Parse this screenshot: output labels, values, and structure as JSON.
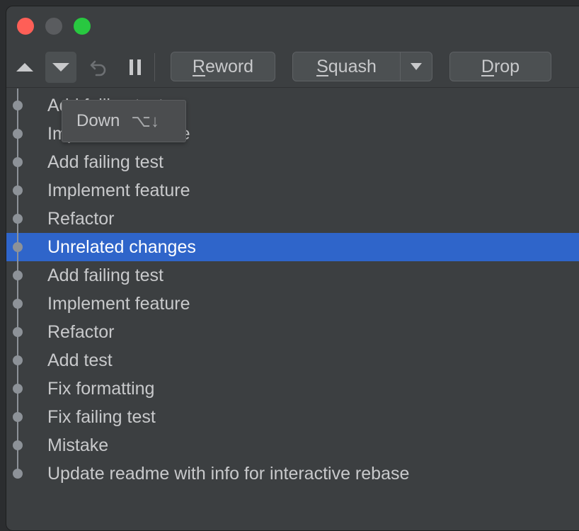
{
  "window": {
    "title": ""
  },
  "toolbar": {
    "move_up_icon": "triangle-up-icon",
    "move_down_icon": "triangle-down-icon",
    "undo_icon": "undo-icon",
    "pause_icon": "pause-icon",
    "reword": {
      "pre": "",
      "mnemonic": "R",
      "post": "eword"
    },
    "squash": {
      "pre": "",
      "mnemonic": "S",
      "post": "quash"
    },
    "drop": {
      "pre": "",
      "mnemonic": "D",
      "post": "rop"
    }
  },
  "tooltip": {
    "label": "Down",
    "shortcut": "⌥↓"
  },
  "commits": [
    {
      "message": "Add failing test",
      "selected": false
    },
    {
      "message": "Implement feature",
      "selected": false
    },
    {
      "message": "Add failing test",
      "selected": false
    },
    {
      "message": "Implement feature",
      "selected": false
    },
    {
      "message": "Refactor",
      "selected": false
    },
    {
      "message": "Unrelated changes",
      "selected": true
    },
    {
      "message": "Add failing test",
      "selected": false
    },
    {
      "message": "Implement feature",
      "selected": false
    },
    {
      "message": "Refactor",
      "selected": false
    },
    {
      "message": "Add test",
      "selected": false
    },
    {
      "message": "Fix formatting",
      "selected": false
    },
    {
      "message": "Fix failing test",
      "selected": false
    },
    {
      "message": "Mistake",
      "selected": false
    },
    {
      "message": "Update readme with info for interactive rebase",
      "selected": false
    }
  ],
  "colors": {
    "selection": "#2f65ca",
    "background": "#3c3f41",
    "graph": "#8d9298"
  }
}
